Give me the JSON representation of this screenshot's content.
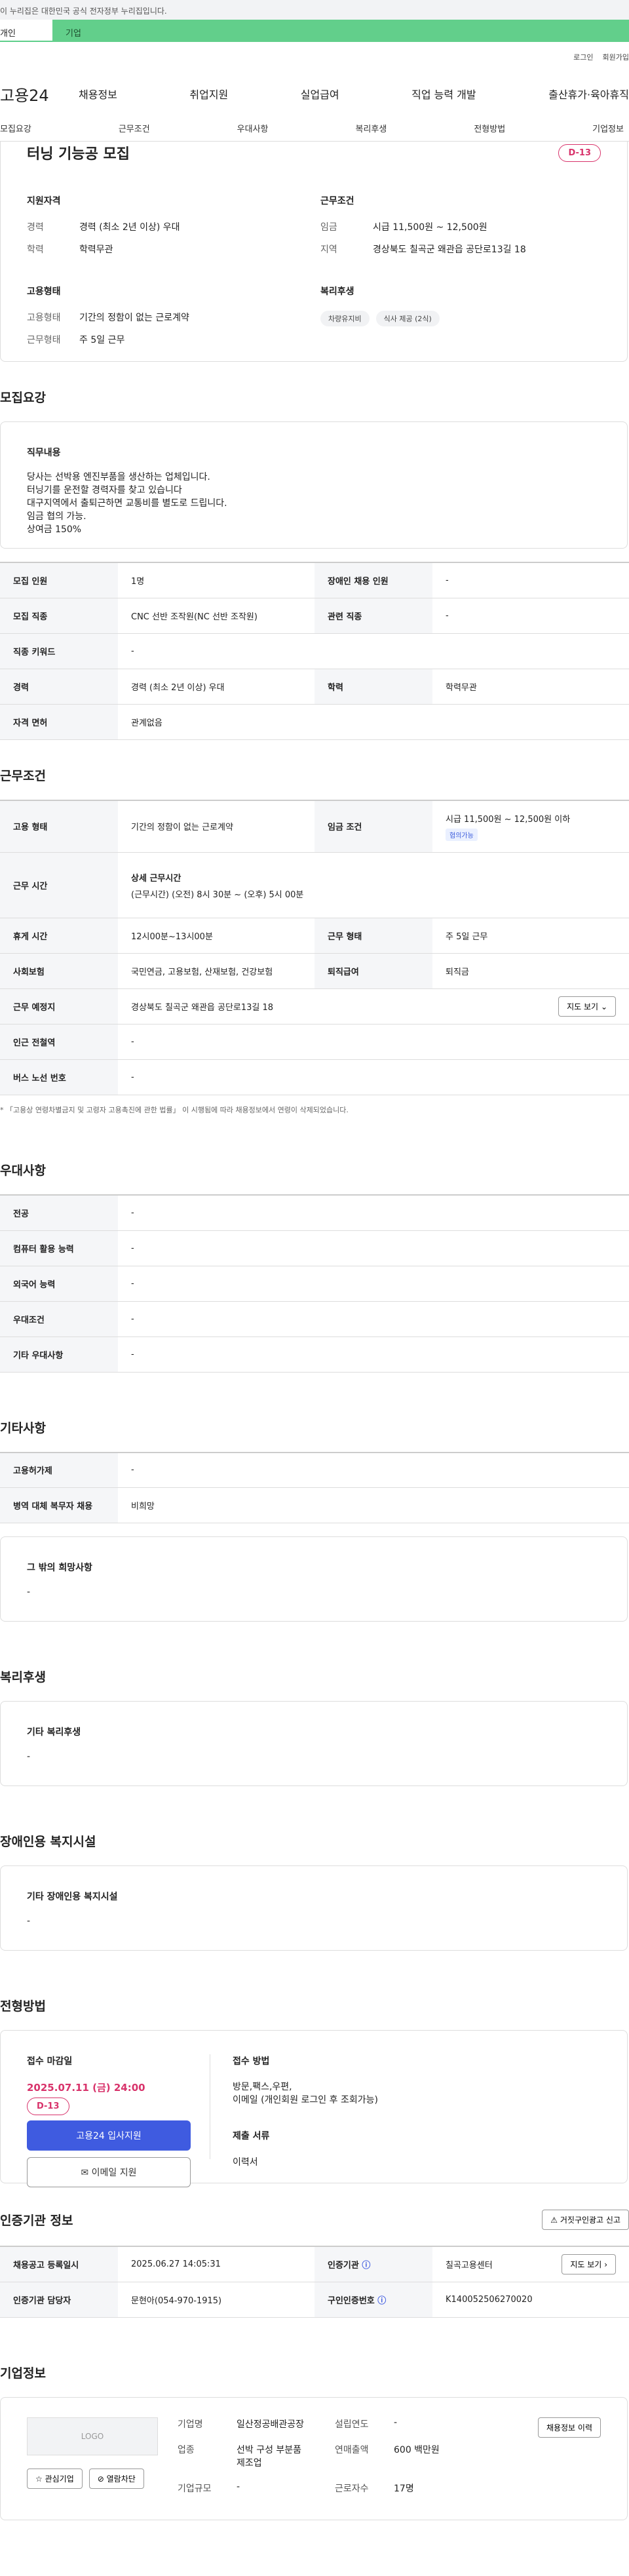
{
  "gov_notice": "이 누리집은 대한민국 공식 전자정부 누리집입니다.",
  "user_tabs": [
    "개인",
    "기업"
  ],
  "util": {
    "login": "로그인",
    "join": "회원가입"
  },
  "brand": "고용24",
  "gnb": [
    "채용정보",
    "취업지원",
    "실업급여",
    "직업 능력 개발",
    "출산휴가·육아휴직"
  ],
  "tabs": [
    "모집요강",
    "근무조건",
    "우대사항",
    "복리후생",
    "전형방법",
    "기업정보"
  ],
  "header": {
    "title": "터닝 기능공 모집",
    "dday": "D-13",
    "qual_title": "지원자격",
    "qual": [
      {
        "k": "경력",
        "v": "경력 (최소 2년 이상) 우대"
      },
      {
        "k": "학력",
        "v": "학력무관"
      }
    ],
    "emp_title": "고용형태",
    "emp": [
      {
        "k": "고용형태",
        "v": "기간의 정함이 없는 근로계약"
      },
      {
        "k": "근무형태",
        "v": "주 5일 근무"
      }
    ],
    "work_title": "근무조건",
    "work": [
      {
        "k": "임금",
        "v": "시급 11,500원 ~ 12,500원"
      },
      {
        "k": "지역",
        "v": "경상북도 칠곡군 왜관읍 공단로13길 18"
      }
    ],
    "welfare_title": "복리후생",
    "welfare_chips": [
      "차량유지비",
      "식사 제공 (2식)"
    ]
  },
  "recruit": {
    "title": "모집요강",
    "duty_title": "직무내용",
    "duty_lines": [
      "당사는 선박용 엔진부품을 생산하는 업체입니다.",
      "터닝기를 운전할 경력자를 찾고 있습니다",
      "대구지역에서 출퇴근하면 교통비를 별도로 드립니다.",
      "임금 협의 가능.",
      "상여금 150%"
    ],
    "rows": [
      {
        "k1": "모집 인원",
        "v1": "1명",
        "k2": "장애인 채용 인원",
        "v2": "-"
      },
      {
        "k1": "모집 직종",
        "v1": "CNC 선반 조작원(NC 선반 조작원)",
        "k2": "관련 직종",
        "v2": "-"
      },
      {
        "k1": "직종 키워드",
        "v1": "-",
        "k2": "",
        "v2": ""
      },
      {
        "k1": "경력",
        "v1": "경력 (최소 2년 이상) 우대",
        "k2": "학력",
        "v2": "학력무관"
      },
      {
        "k1": "자격 면허",
        "v1": "관계없음",
        "k2": "",
        "v2": ""
      }
    ]
  },
  "conditions": {
    "title": "근무조건",
    "emp_type_k": "고용 형태",
    "emp_type_v": "기간의 정함이 없는 근로계약",
    "wage_k": "임금 조건",
    "wage_v": "시급 11,500원 ~ 12,500원 이하",
    "wage_badge": "협의가능",
    "hours_k": "근무 시간",
    "hours_title": "상세 근무시간",
    "hours_v": "(근무시간) (오전) 8시 30분 ~ (오후) 5시 00분",
    "break_k": "휴게 시간",
    "break_v": "12시00분~13시00분",
    "shift_k": "근무 형태",
    "shift_v": "주 5일 근무",
    "ins_k": "사회보험",
    "ins_v": "국민연금, 고용보험, 산재보험, 건강보험",
    "retire_k": "퇴직급여",
    "retire_v": "퇴직금",
    "loc_k": "근무 예정지",
    "loc_v": "경상북도 칠곡군 왜관읍 공단로13길 18",
    "map_btn": "지도 보기",
    "subway_k": "인근 전철역",
    "subway_v": "-",
    "bus_k": "버스 노선 번호",
    "bus_v": "-",
    "note": "* 「고용상 연령차별금지 및 고령자 고용촉진에 관한 법률」 이 시행됨에 따라 채용정보에서 연령이 삭제되었습니다."
  },
  "prefer": {
    "title": "우대사항",
    "rows": [
      {
        "k": "전공",
        "v": "-"
      },
      {
        "k": "컴퓨터 활용 능력",
        "v": "-"
      },
      {
        "k": "외국어 능력",
        "v": "-"
      },
      {
        "k": "우대조건",
        "v": "-"
      },
      {
        "k": "기타 우대사항",
        "v": "-"
      }
    ]
  },
  "etc": {
    "title": "기타사항",
    "rows": [
      {
        "k": "고용허가제",
        "v": "-"
      },
      {
        "k": "병역 대체 복무자 채용",
        "v": "비희망"
      }
    ],
    "other_title": "그 밖의 희망사항",
    "other_v": "-"
  },
  "welfare": {
    "title": "복리후생",
    "box_title": "기타 복리후생",
    "box_v": "-"
  },
  "disabled": {
    "title": "장애인용 복지시설",
    "box_title": "기타 장애인용 복지시설",
    "box_v": "-"
  },
  "apply": {
    "title": "전형방법",
    "deadline_title": "접수 마감일",
    "deadline": "2025.07.11 (금) 24:00",
    "dday": "D-13",
    "apply_btn": "고용24 입사지원",
    "email_btn": "이메일 지원",
    "method_title": "접수 방법",
    "method_lines": [
      "방문,팩스,우편,",
      "이메일 (개인회원 로그인 후 조회가능)"
    ],
    "docs_title": "제출 서류",
    "docs_v": "이력서"
  },
  "org": {
    "title": "인증기관 정보",
    "report_btn": "거짓구인광고 신고",
    "reg_k": "채용공고 등록일시",
    "reg_v": "2025.06.27 14:05:31",
    "org_k": "인증기관",
    "org_v": "칠곡고용센터",
    "map_btn": "지도 보기",
    "mgr_k": "인증기관 담당자",
    "mgr_v": "문현아(054-970-1915)",
    "cert_k": "구인인증번호",
    "cert_v": "K140052506270020"
  },
  "company": {
    "title": "기업정보",
    "logo": "LOGO",
    "fav_btn": "관심기업",
    "block_btn": "열람차단",
    "name_k": "기업명",
    "name_v": "일산정공배관공장",
    "ind_k": "업종",
    "ind_v": [
      "선박 구성 부분품",
      "제조업"
    ],
    "size_k": "기업규모",
    "size_v": "-",
    "year_k": "설립연도",
    "year_v": "-",
    "sales_k": "연매출액",
    "sales_v": "600 백만원",
    "emp_k": "근로자수",
    "emp_v": "17명",
    "history_btn": "채용정보 이력"
  }
}
